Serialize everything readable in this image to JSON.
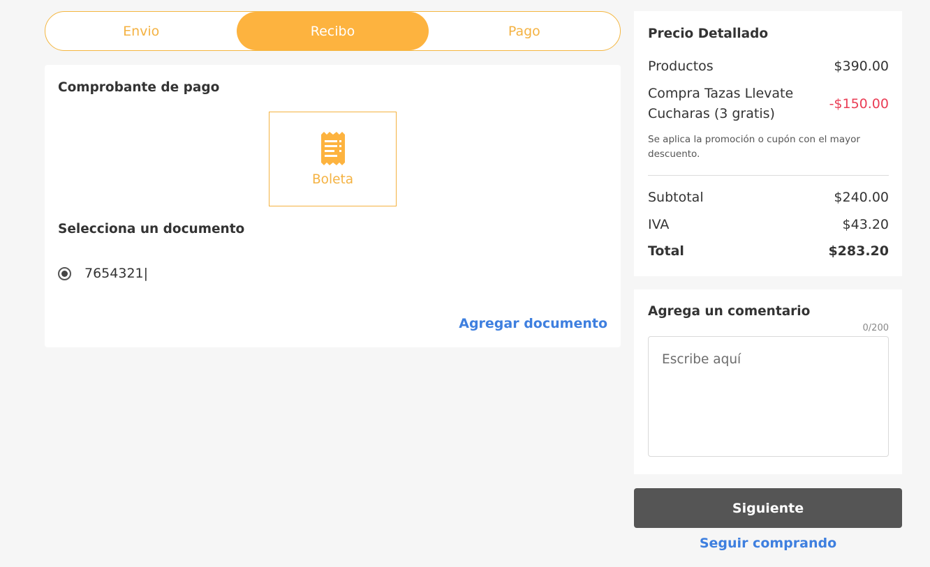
{
  "stepper": {
    "steps": [
      {
        "label": "Envio"
      },
      {
        "label": "Recibo"
      },
      {
        "label": "Pago"
      }
    ]
  },
  "document_section": {
    "title": "Comprobante de pago",
    "receipt_option": {
      "label": "Boleta",
      "icon": "receipt-icon"
    },
    "select_title": "Selecciona un documento",
    "documents": [
      {
        "label": "7654321|"
      }
    ],
    "add_link": "Agregar documento"
  },
  "summary": {
    "title": "Precio Detallado",
    "products_label": "Productos",
    "products_value": "$390.00",
    "promo_name": "Compra Tazas Llevate Cucharas (3 gratis)",
    "promo_value": "-$150.00",
    "note": "Se aplica la promoción o cupón con el mayor descuento.",
    "subtotal_label": "Subtotal",
    "subtotal_value": "$240.00",
    "tax_label": "IVA",
    "tax_value": "$43.20",
    "total_label": "Total",
    "total_value": "$283.20"
  },
  "comment": {
    "title": "Agrega un comentario",
    "counter": "0/200",
    "placeholder": "Escribe aquí"
  },
  "actions": {
    "next_label": "Siguiente",
    "continue_label": "Seguir comprando"
  },
  "colors": {
    "accent": "#fdb33f",
    "link": "#3e7fdf",
    "discount": "#ea3d55",
    "button": "#555555"
  }
}
